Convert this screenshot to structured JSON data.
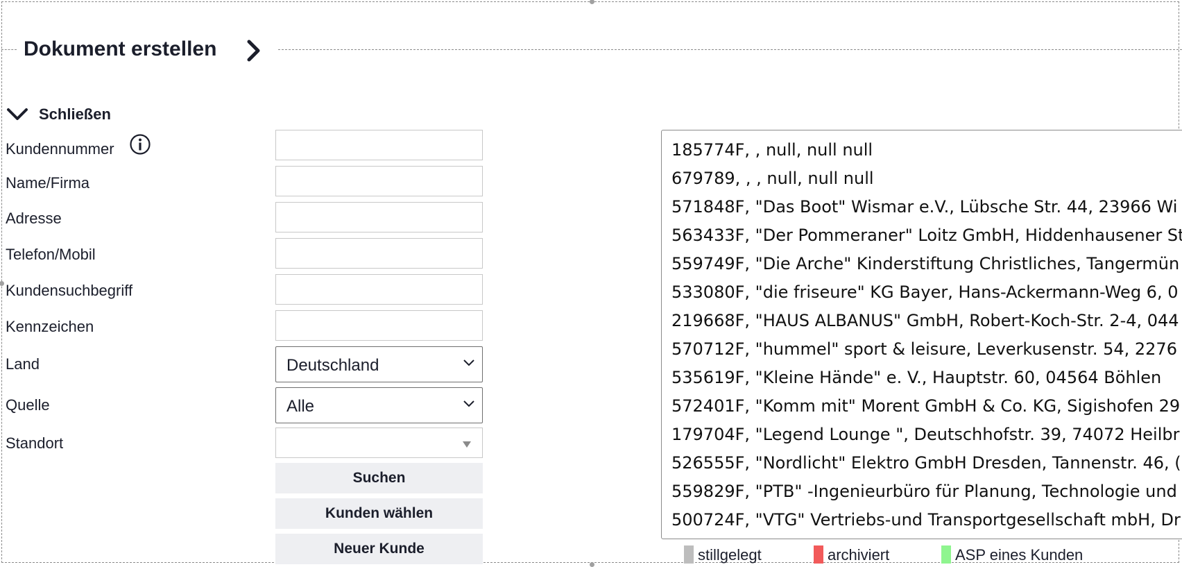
{
  "header": {
    "title": "Dokument erstellen",
    "chevron_icon": "chevron-right-icon"
  },
  "form": {
    "collapse_label": "Schließen",
    "collapse_icon": "chevron-down-icon",
    "fields": {
      "kundennummer": {
        "label": "Kundennummer",
        "value": "",
        "info_icon": "info-icon"
      },
      "name": {
        "label": "Name/Firma",
        "value": ""
      },
      "adresse": {
        "label": "Adresse",
        "value": ""
      },
      "telefon": {
        "label": "Telefon/Mobil",
        "value": ""
      },
      "suchbegriff": {
        "label": "Kundensuchbegriff",
        "value": ""
      },
      "kennzeichen": {
        "label": "Kennzeichen",
        "value": ""
      },
      "land": {
        "label": "Land",
        "value": "Deutschland"
      },
      "quelle": {
        "label": "Quelle",
        "value": "Alle"
      },
      "standort": {
        "label": "Standort",
        "value": ""
      }
    },
    "buttons": {
      "search": "Suchen",
      "choose": "Kunden wählen",
      "new": "Neuer Kunde"
    }
  },
  "results": [
    "185774F, , null, null null",
    "679789, , , null, null null",
    "571848F, \"Das Boot\" Wismar e.V., Lübsche Str. 44, 23966 Wi",
    "563433F, \"Der Pommeraner\" Loitz GmbH, Hiddenhausener St",
    "559749F, \"Die Arche\" Kinderstiftung Christliches, Tangermün",
    "533080F, \"die friseure\" KG Bayer, Hans-Ackermann-Weg 6, 0",
    "219668F, \"HAUS ALBANUS\" GmbH, Robert-Koch-Str. 2-4, 044",
    "570712F, \"hummel\" sport & leisure, Leverkusenstr. 54, 2276",
    "535619F, \"Kleine Hände\" e. V., Hauptstr. 60, 04564 Böhlen",
    "572401F, \"Komm mit\" Morent GmbH & Co. KG, Sigishofen 29",
    "179704F, \"Legend Lounge \", Deutschhofstr. 39, 74072 Heilbr",
    "526555F, \"Nordlicht\" Elektro GmbH Dresden, Tannenstr. 46, (",
    "559829F, \"PTB\" -Ingenieurbüro für Planung, Technologie und",
    "500724F, \"VTG\" Vertriebs-und Transportgesellschaft mbH, Dr"
  ],
  "legend": [
    {
      "label": "stillgelegt",
      "color": "#bdbdbd"
    },
    {
      "label": "archiviert",
      "color": "#f25a5a"
    },
    {
      "label": "ASP eines Kunden",
      "color": "#8ff58f"
    }
  ]
}
